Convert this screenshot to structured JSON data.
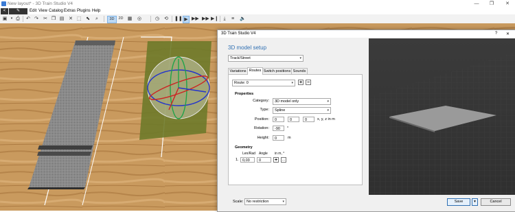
{
  "window": {
    "title": "New layout* - 3D Train Studio V4",
    "controls": [
      "—",
      "❐",
      "✕"
    ]
  },
  "menu": {
    "back": "<",
    "edit_icon": "✎",
    "items": [
      "Edit",
      "View",
      "Catalog",
      "Extras",
      "Plugins",
      "Help"
    ]
  },
  "toolbar": {
    "view3d": "3D",
    "view2d": "2D"
  },
  "dialog": {
    "title": "3D Train Studio V4",
    "help": "?",
    "close": "✕",
    "heading": "3D model setup",
    "type_select": "Track/Street",
    "tabs": [
      "Variations",
      "Routes",
      "Switch positions",
      "Sounds"
    ],
    "active_tab": "Routes",
    "route_select": "Route: 0",
    "route_add": "+",
    "route_remove": "−",
    "properties": {
      "title": "Properties",
      "category_label": "Category:",
      "category_value": "3D model only",
      "type_label": "Type:",
      "type_value": "Spline",
      "position_label": "Position:",
      "position_values": [
        "0",
        "0",
        "0"
      ],
      "position_unit": "x, y, z in m",
      "rotation_label": "Rotation:",
      "rotation_value": "-90",
      "rotation_unit": "°",
      "height_label": "Height:",
      "height_value": "0",
      "height_unit": "m"
    },
    "geometry": {
      "title": "Geometry",
      "col_len": "Len/Rad",
      "col_angle": "Angle",
      "col_unit": "in m, °",
      "row_index": "1.",
      "row_len": "0,03",
      "row_angle": "0",
      "add": "+",
      "more": "..."
    },
    "footer": {
      "scale_label": "Scale:",
      "scale_value": "No restriction",
      "save": "Save",
      "cancel": "Cancel"
    }
  }
}
